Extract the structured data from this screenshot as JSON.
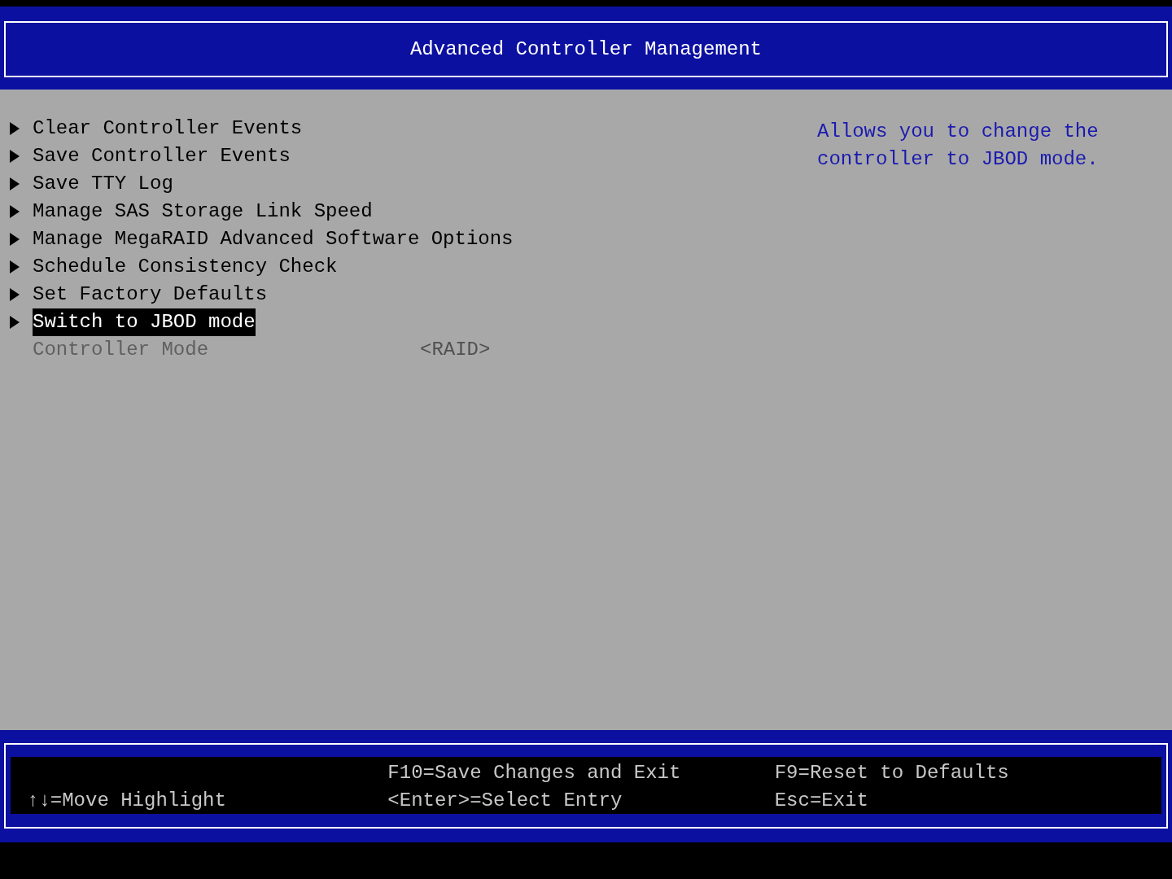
{
  "window": {
    "title": "Advanced Controller Management"
  },
  "menu": [
    {
      "kind": "submenu",
      "label": "Clear Controller Events",
      "selected": false
    },
    {
      "kind": "submenu",
      "label": "Save Controller Events",
      "selected": false
    },
    {
      "kind": "submenu",
      "label": "Save TTY Log",
      "selected": false
    },
    {
      "kind": "submenu",
      "label": "Manage SAS Storage Link Speed",
      "selected": false
    },
    {
      "kind": "submenu",
      "label": "Manage MegaRAID Advanced Software Options",
      "selected": false
    },
    {
      "kind": "submenu",
      "label": "Schedule Consistency Check",
      "selected": false
    },
    {
      "kind": "submenu",
      "label": "Set Factory Defaults",
      "selected": false
    },
    {
      "kind": "submenu",
      "label": "Switch to JBOD mode",
      "selected": true
    },
    {
      "kind": "setting",
      "label": "Controller Mode",
      "value": "<RAID>",
      "selected": false,
      "disabled": true
    }
  ],
  "help": "Allows you to change the controller to JBOD mode.",
  "footer": {
    "columns": [
      [
        "↑↓=Move Highlight"
      ],
      [
        "F10=Save Changes and Exit",
        "<Enter>=Select Entry"
      ],
      [
        "F9=Reset to Defaults",
        "Esc=Exit"
      ]
    ]
  }
}
